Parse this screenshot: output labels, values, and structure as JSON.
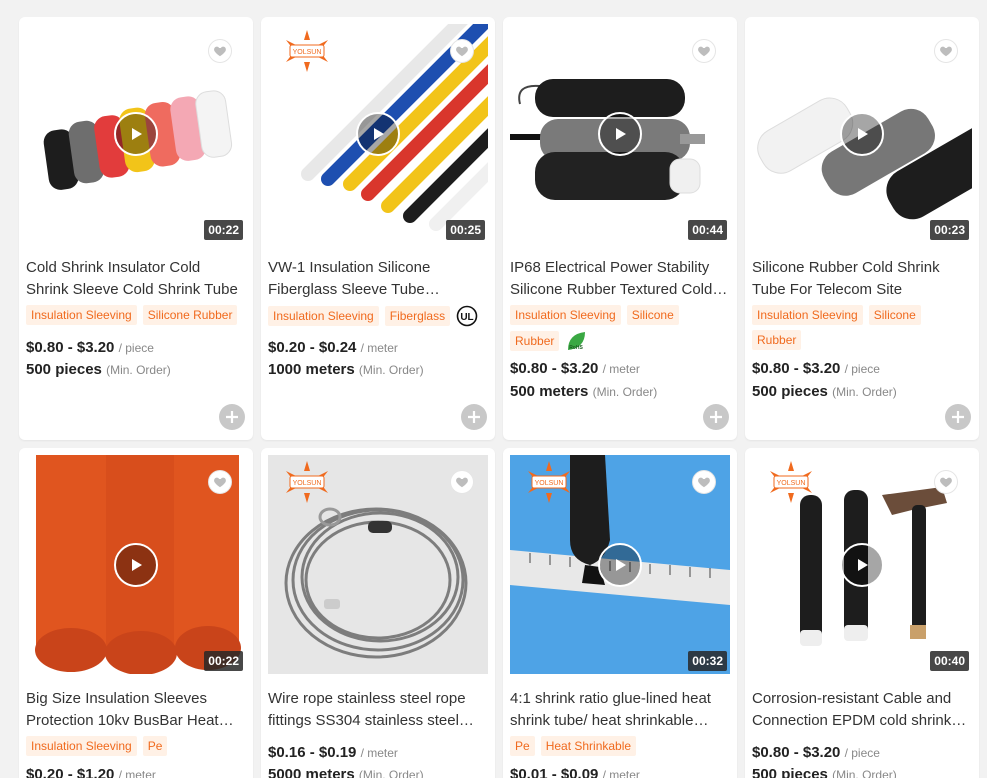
{
  "products": [
    {
      "title": "Cold Shrink Insulator Cold Shrink Sleeve Cold Shrink Tube",
      "duration": "00:22",
      "tags": [
        "Insulation Sleeving",
        "Silicone Rubber"
      ],
      "price_range": "$0.80 - $3.20",
      "price_unit": "/ piece",
      "moq": "500 pieces",
      "moq_label": "(Min. Order)",
      "has_logo": false
    },
    {
      "title": "VW-1 Insulation Silicone Fiberglass Sleeve Tube…",
      "duration": "00:25",
      "tags": [
        "Insulation Sleeving",
        "Fiberglass"
      ],
      "cert": "UL",
      "price_range": "$0.20 - $0.24",
      "price_unit": "/ meter",
      "moq": "1000 meters",
      "moq_label": "(Min. Order)",
      "has_logo": true
    },
    {
      "title": "IP68 Electrical Power Stability Silicone Rubber Textured Cold…",
      "duration": "00:44",
      "tags": [
        "Insulation Sleeving",
        "Silicone",
        "Rubber"
      ],
      "cert": "RoHS",
      "price_range": "$0.80 - $3.20",
      "price_unit": "/ meter",
      "moq": "500 meters",
      "moq_label": "(Min. Order)",
      "has_logo": false
    },
    {
      "title": "Silicone Rubber Cold Shrink Tube For Telecom Site",
      "duration": "00:23",
      "tags": [
        "Insulation Sleeving",
        "Silicone",
        "Rubber"
      ],
      "price_range": "$0.80 - $3.20",
      "price_unit": "/ piece",
      "moq": "500 pieces",
      "moq_label": "(Min. Order)",
      "has_logo": false
    },
    {
      "title": "Big Size Insulation Sleeves Protection 10kv BusBar Heat…",
      "duration": "00:22",
      "tags": [
        "Insulation Sleeving",
        "Pe"
      ],
      "price_range": "$0.20 - $1.20",
      "price_unit": "/ meter",
      "moq": "",
      "moq_label": "",
      "has_logo": false
    },
    {
      "title": "Wire rope stainless steel rope fittings SS304 stainless steel…",
      "duration": "",
      "tags": [],
      "price_range": "$0.16 - $0.19",
      "price_unit": "/ meter",
      "moq": "5000 meters",
      "moq_label": "(Min. Order)",
      "has_logo": true
    },
    {
      "title": "4:1 shrink ratio glue-lined heat shrink tube/ heat shrinkable…",
      "duration": "00:32",
      "tags": [
        "Pe",
        "Heat Shrinkable"
      ],
      "price_range": "$0.01 - $0.09",
      "price_unit": "/ meter",
      "moq": "",
      "moq_label": "",
      "has_logo": true
    },
    {
      "title": "Corrosion-resistant Cable and Connection EPDM cold shrink…",
      "duration": "00:40",
      "tags": [],
      "price_range": "$0.80 - $3.20",
      "price_unit": "/ piece",
      "moq": "500 pieces",
      "moq_label": "(Min. Order)",
      "has_logo": true
    }
  ],
  "logo_text": "YOLSUN",
  "colors": {
    "tag_bg": "#fff1e6",
    "tag_text": "#f06a1e",
    "accent": "#f06a1e"
  },
  "icons": {
    "favorite": "heart-icon",
    "play": "play-icon",
    "add": "plus-icon"
  }
}
